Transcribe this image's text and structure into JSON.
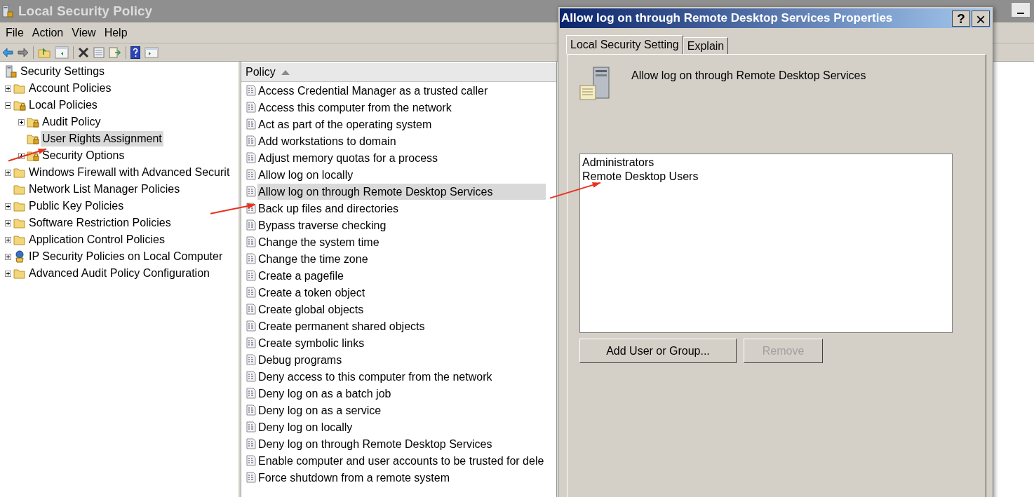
{
  "window": {
    "title": "Local Security Policy"
  },
  "menu": [
    "File",
    "Action",
    "View",
    "Help"
  ],
  "tree": {
    "label": "Security Settings",
    "selected": false,
    "children": [
      {
        "label": "Account Policies",
        "expandable": true,
        "expanded": false,
        "selected": false
      },
      {
        "label": "Local Policies",
        "expandable": true,
        "expanded": true,
        "selected": false,
        "children": [
          {
            "label": "Audit Policy",
            "expandable": true,
            "expanded": false,
            "selected": false
          },
          {
            "label": "User Rights Assignment",
            "expandable": false,
            "selected": true
          },
          {
            "label": "Security Options",
            "expandable": true,
            "expanded": false,
            "selected": false
          }
        ]
      },
      {
        "label": "Windows Firewall with Advanced Securit",
        "expandable": true,
        "expanded": false,
        "selected": false
      },
      {
        "label": "Network List Manager Policies",
        "expandable": false,
        "selected": false
      },
      {
        "label": "Public Key Policies",
        "expandable": true,
        "expanded": false,
        "selected": false
      },
      {
        "label": "Software Restriction Policies",
        "expandable": true,
        "expanded": false,
        "selected": false
      },
      {
        "label": "Application Control Policies",
        "expandable": true,
        "expanded": false,
        "selected": false
      },
      {
        "label": "IP Security Policies on Local Computer",
        "expandable": true,
        "expanded": false,
        "selected": false,
        "kind": "ipsec"
      },
      {
        "label": "Advanced Audit Policy Configuration",
        "expandable": true,
        "expanded": false,
        "selected": false
      }
    ]
  },
  "policy_list": {
    "column": "Policy",
    "rows": [
      {
        "name": "Access Credential Manager as a trusted caller",
        "selected": false
      },
      {
        "name": "Access this computer from the network",
        "selected": false
      },
      {
        "name": "Act as part of the operating system",
        "selected": false
      },
      {
        "name": "Add workstations to domain",
        "selected": false
      },
      {
        "name": "Adjust memory quotas for a process",
        "selected": false
      },
      {
        "name": "Allow log on locally",
        "selected": false
      },
      {
        "name": "Allow log on through Remote Desktop Services",
        "selected": true
      },
      {
        "name": "Back up files and directories",
        "selected": false
      },
      {
        "name": "Bypass traverse checking",
        "selected": false
      },
      {
        "name": "Change the system time",
        "selected": false
      },
      {
        "name": "Change the time zone",
        "selected": false
      },
      {
        "name": "Create a pagefile",
        "selected": false
      },
      {
        "name": "Create a token object",
        "selected": false
      },
      {
        "name": "Create global objects",
        "selected": false
      },
      {
        "name": "Create permanent shared objects",
        "selected": false
      },
      {
        "name": "Create symbolic links",
        "selected": false
      },
      {
        "name": "Debug programs",
        "selected": false
      },
      {
        "name": "Deny access to this computer from the network",
        "selected": false
      },
      {
        "name": "Deny log on as a batch job",
        "selected": false
      },
      {
        "name": "Deny log on as a service",
        "selected": false
      },
      {
        "name": "Deny log on locally",
        "selected": false
      },
      {
        "name": "Deny log on through Remote Desktop Services",
        "selected": false
      },
      {
        "name": "Enable computer and user accounts to be trusted for dele",
        "selected": false
      },
      {
        "name": "Force shutdown from a remote system",
        "selected": false
      }
    ]
  },
  "dialog": {
    "title": "Allow log on through Remote Desktop Services Properties",
    "help_button": "?",
    "close_button": "×",
    "tabs": [
      {
        "label": "Local Security Setting",
        "selected": true
      },
      {
        "label": "Explain",
        "selected": false
      }
    ],
    "policy_name": "Allow log on through Remote Desktop Services",
    "members": [
      "Administrators",
      "Remote Desktop Users"
    ],
    "buttons": [
      {
        "label": "Add User or Group...",
        "disabled": false
      },
      {
        "label": "Remove",
        "disabled": true
      }
    ]
  }
}
